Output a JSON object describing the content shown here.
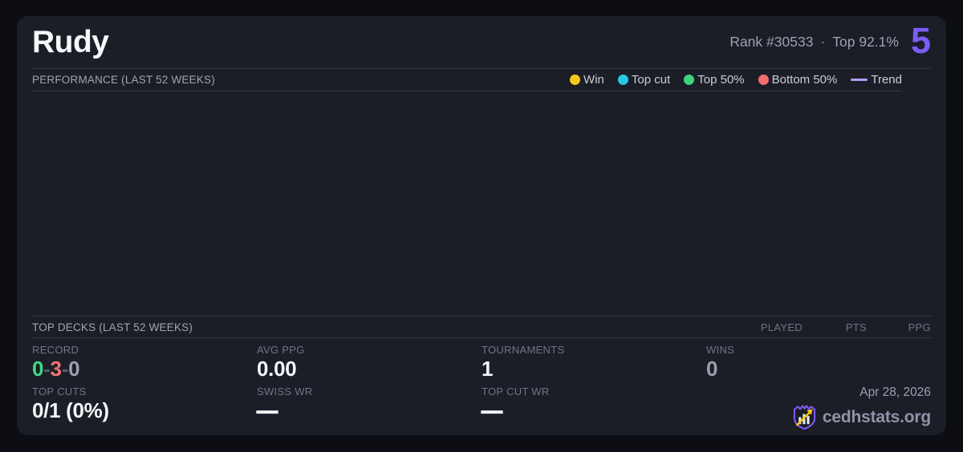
{
  "card": {
    "player_name": "Rudy",
    "rank_text": "Rank #30533",
    "separator": "·",
    "percentile_text": "Top 92.1%",
    "score": "5"
  },
  "performance": {
    "section_title": "PERFORMANCE (LAST 52 WEEKS)",
    "legend": {
      "win": {
        "label": "Win",
        "color": "#f5c71a"
      },
      "top_cut": {
        "label": "Top cut",
        "color": "#29c7e4"
      },
      "top50": {
        "label": "Top 50%",
        "color": "#3ed47e"
      },
      "bottom50": {
        "label": "Bottom 50%",
        "color": "#f26d6d"
      },
      "trend": {
        "label": "Trend",
        "color": "#b39df5"
      }
    },
    "data_points": []
  },
  "top_decks": {
    "section_title": "TOP DECKS (LAST 52 WEEKS)",
    "columns": [
      "PLAYED",
      "PTS",
      "PPG"
    ],
    "rows": []
  },
  "stats": {
    "record": {
      "label": "RECORD",
      "wins": "0",
      "losses": "3",
      "draws": "0",
      "separator": "-"
    },
    "avg_ppg": {
      "label": "AVG PPG",
      "value": "0.00"
    },
    "tournaments": {
      "label": "TOURNAMENTS",
      "value": "1"
    },
    "wins": {
      "label": "WINS",
      "value": "0"
    },
    "top_cuts": {
      "label": "TOP CUTS",
      "value": "0/1 (0%)"
    },
    "swiss_wr": {
      "label": "SWISS WR",
      "value": "—"
    },
    "top_cut_wr": {
      "label": "TOP CUT WR",
      "value": "—"
    }
  },
  "footer": {
    "date": "Apr 28, 2026",
    "brand": "cedhstats.org"
  },
  "colors": {
    "page_bg": "#0d0e13",
    "card_bg": "#1b1d27",
    "divider": "#353b49",
    "accent_purple": "#7c5cf6",
    "trend_purple": "#b39df5",
    "win_yellow": "#f5c71a",
    "top_cut_cyan": "#29c7e4",
    "top50_green": "#3ed47e",
    "bottom50_red": "#f26d6d",
    "record_green": "#3ddc84",
    "record_red": "#f07575",
    "text_primary": "#f3f4f6",
    "text_muted": "#6f7687",
    "brand_yellow": "#f2c318"
  }
}
